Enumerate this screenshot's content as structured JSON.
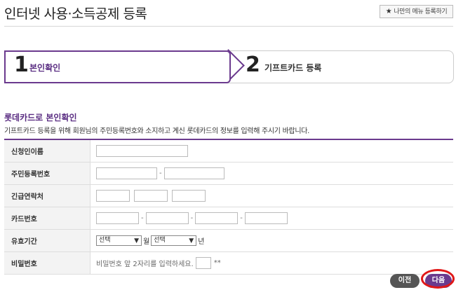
{
  "page": {
    "title": "인터넷 사용·소득공제 등록",
    "favorite_label": "나만의 메뉴 등록하기",
    "favorite_icon": "star-icon"
  },
  "steps": [
    {
      "number": "1",
      "label": "본인확인",
      "active": true
    },
    {
      "number": "2",
      "label": "기프트카드 등록",
      "active": false
    }
  ],
  "section": {
    "heading": "롯데카드로 본인확인",
    "description": "기프트카드 등록을 위해 회원님의 주민등록번호와 소지하고 계신 롯데카드의 정보를 입력해 주시기 바랍니다."
  },
  "form": {
    "name_label": "신청인이름",
    "ssn_label": "주민등록번호",
    "phone_label": "긴급연락처",
    "card_label": "카드번호",
    "expiry_label": "유효기간",
    "expiry_month_value": "선택",
    "expiry_month_unit": "월",
    "expiry_year_value": "선택",
    "expiry_year_unit": "년",
    "password_label": "비밀번호",
    "password_hint": "비밀번호 앞 2자리를 입력하세요.",
    "password_mask": "**",
    "dash": "-"
  },
  "buttons": {
    "prev": "이전",
    "next": "다음"
  },
  "colors": {
    "accent": "#6b3a8e",
    "highlight_ring": "#e01818",
    "prev_button": "#555555"
  }
}
